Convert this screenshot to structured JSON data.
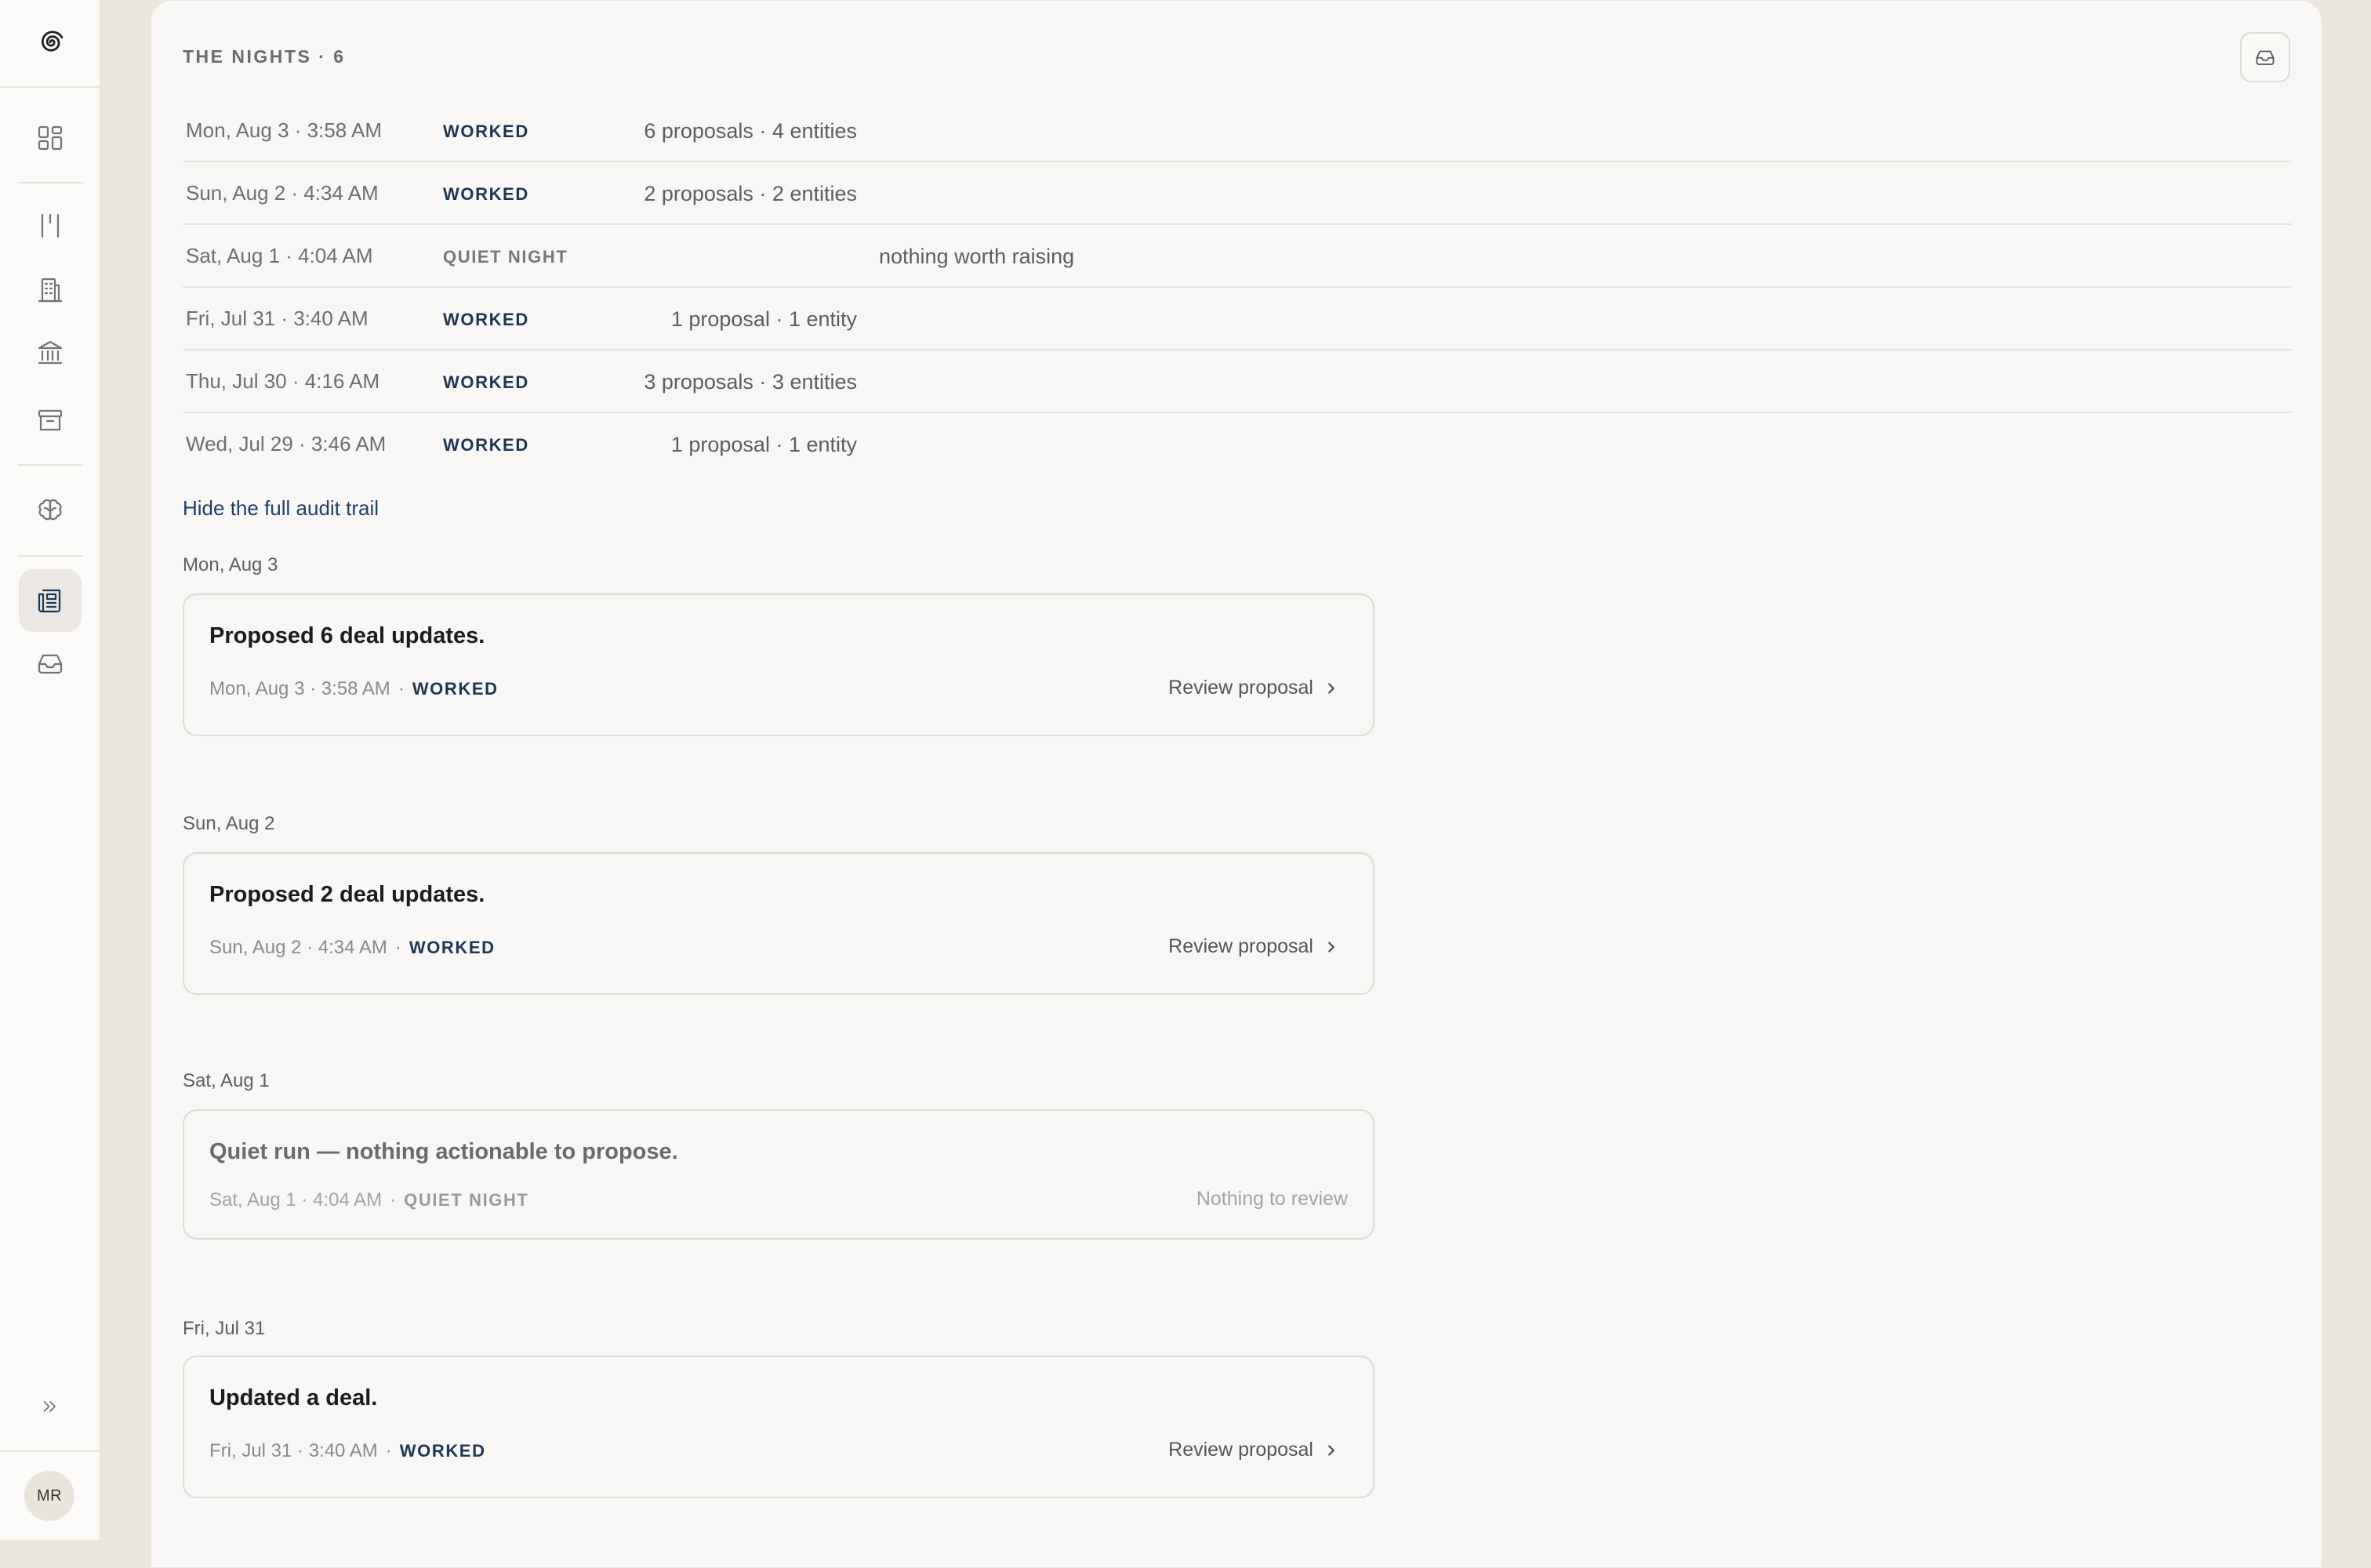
{
  "user": {
    "initials": "MR"
  },
  "sidebar": {
    "icons": [
      "spiral-logo-icon",
      "dashboard-grid-icon",
      "pipeline-columns-icon",
      "building-icon",
      "bank-icon",
      "archive-icon",
      "brain-icon",
      "newspaper-icon",
      "inbox-icon",
      "expand-chevrons-icon"
    ]
  },
  "nights": {
    "header": "THE NIGHTS · 6",
    "rows": [
      {
        "date": "Mon, Aug 3 · 3:58 AM",
        "status": "WORKED",
        "summary": "6 proposals · 4 entities",
        "note": ""
      },
      {
        "date": "Sun, Aug 2 · 4:34 AM",
        "status": "WORKED",
        "summary": "2 proposals · 2 entities",
        "note": ""
      },
      {
        "date": "Sat, Aug 1 · 4:04 AM",
        "status": "QUIET NIGHT",
        "summary": "",
        "note": "nothing worth raising"
      },
      {
        "date": "Fri, Jul 31 · 3:40 AM",
        "status": "WORKED",
        "summary": "1 proposal · 1 entity",
        "note": ""
      },
      {
        "date": "Thu, Jul 30 · 4:16 AM",
        "status": "WORKED",
        "summary": "3 proposals · 3 entities",
        "note": ""
      },
      {
        "date": "Wed, Jul 29 · 3:46 AM",
        "status": "WORKED",
        "summary": "1 proposal · 1 entity",
        "note": ""
      }
    ]
  },
  "audit": {
    "toggle_label": "Hide the full audit trail",
    "dot": "·",
    "groups": [
      {
        "date": "Mon, Aug 3",
        "title": "Proposed 6 deal updates.",
        "timestamp": "Mon, Aug 3 · 3:58 AM",
        "status": "WORKED",
        "action": "Review proposal"
      },
      {
        "date": "Sun, Aug 2",
        "title": "Proposed 2 deal updates.",
        "timestamp": "Sun, Aug 2 · 4:34 AM",
        "status": "WORKED",
        "action": "Review proposal"
      },
      {
        "date": "Sat, Aug 1",
        "title": "Quiet run — nothing actionable to propose.",
        "timestamp": "Sat, Aug 1 · 4:04 AM",
        "status": "QUIET NIGHT",
        "action": "Nothing to review"
      },
      {
        "date": "Fri, Jul 31",
        "title": "Updated a deal.",
        "timestamp": "Fri, Jul 31 · 3:40 AM",
        "status": "WORKED",
        "action": "Review proposal"
      }
    ]
  }
}
